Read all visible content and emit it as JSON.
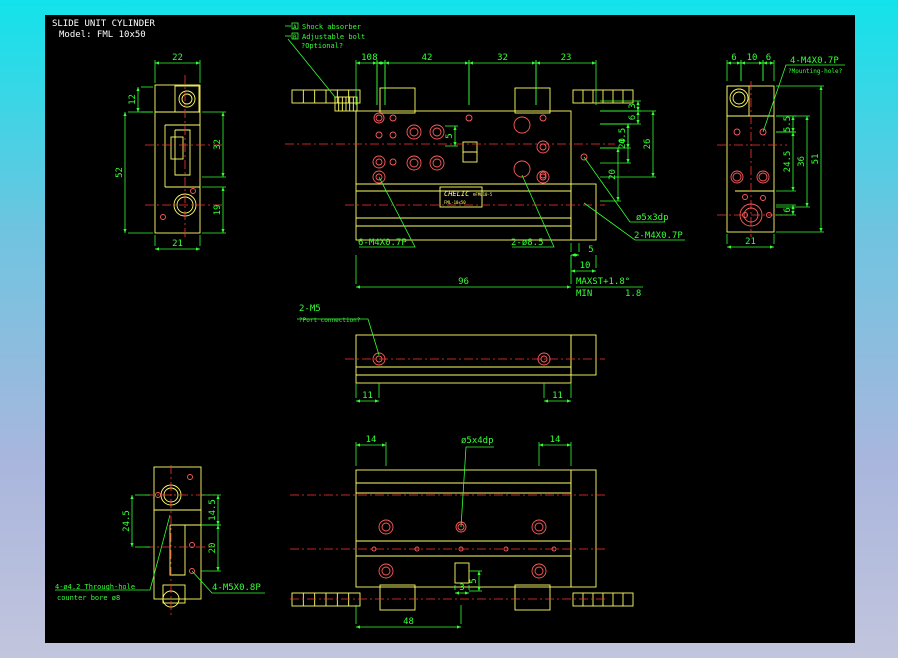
{
  "title": {
    "line1": "SLIDE UNIT CYLINDER",
    "line2": "Model: FML 10x50"
  },
  "legend": {
    "shock_absorber": "Shock absorber",
    "adjustable_bolt": "Adjustable bolt",
    "optional": "?Optional?",
    "mark_a": "A",
    "mark_b": "B"
  },
  "dims": {
    "side_top_width": "22",
    "side_12": "12",
    "side_52": "52",
    "side_32": "32",
    "side_19": "19",
    "side_bottom_21": "21",
    "top_10": "10",
    "top_8": "8",
    "top_42": "42",
    "top_32": "32",
    "top_23": "23",
    "r_3": "3",
    "r_6": "6",
    "r_4_5": "4.5",
    "r_20a": "20",
    "r_26": "26",
    "r_20b": "20",
    "mid_5": "5",
    "mid_96": "96",
    "mid_5b": "5",
    "mid_10": "10",
    "maxst": "MAXST+1.8°",
    "min_label": "MIN",
    "min_val": "1.8",
    "end_6a": "6",
    "end_10": "10",
    "end_6b": "6",
    "end_5_5": "5.5",
    "end_24_5": "24.5",
    "end_36": "36",
    "end_51": "51",
    "end_6c": "6",
    "end_bottom_21": "21",
    "port_11a": "11",
    "port_11b": "11",
    "bot_14a": "14",
    "bot_14b": "14",
    "bot_3": "3",
    "bot_5": "5",
    "bot_48": "48",
    "bl_24_5": "24.5",
    "bl_14_5": "14.5",
    "bl_20": "20"
  },
  "callouts": {
    "m4_6": "6-M4X0.7P",
    "phi85": "2-ø8.5",
    "phi5x3": "ø5x3dp",
    "m4_2": "2-M4X0.7P",
    "m4_4": "4-M4X0.7P",
    "mounting": "?Mounting-hole?",
    "m5_2": "2-M5",
    "port_conn": "?Port connection?",
    "phi5x4": "ø5x4dp",
    "thru_hole": "4-ø4.2 Through-hole",
    "counter_bore": "counter bore  ø8",
    "m5x08": "4-M5X0.8P"
  },
  "nameplate": {
    "brand": "CHELIC",
    "model": "FML-10x50",
    "small": "®FML10-5"
  },
  "colors": {
    "screen": "#000000",
    "part": "#ffff66",
    "dimension": "#33ff33",
    "centerline": "#ff3333",
    "hole": "#ff5a5a",
    "text": "#ffffff"
  }
}
